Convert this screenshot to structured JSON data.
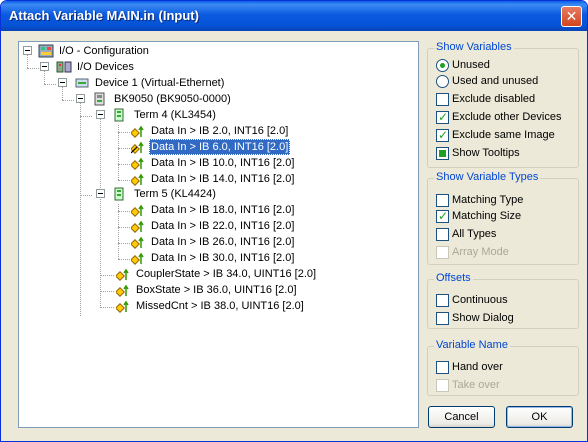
{
  "window": {
    "title": "Attach Variable MAIN.in (Input)",
    "close_glyph": "✕"
  },
  "tree": {
    "root": "I/O - Configuration",
    "io_devices": "I/O Devices",
    "device1": "Device 1 (Virtual-Ethernet)",
    "bk9050": "BK9050 (BK9050-0000)",
    "term4": "Term 4 (KL3454)",
    "term4_vars": [
      "Data In   >   IB 2.0, INT16 [2.0]",
      "Data In   >   IB 6.0, INT16 [2.0]",
      "Data In   >   IB 10.0, INT16 [2.0]",
      "Data In   >   IB 14.0, INT16 [2.0]"
    ],
    "term5": "Term 5 (KL4424)",
    "term5_vars": [
      "Data In   >   IB 18.0, INT16 [2.0]",
      "Data In   >   IB 22.0, INT16 [2.0]",
      "Data In   >   IB 26.0, INT16 [2.0]",
      "Data In   >   IB 30.0, INT16 [2.0]"
    ],
    "coupler_state": "CouplerState   >   IB 34.0, UINT16 [2.0]",
    "box_state": "BoxState   >   IB 36.0, UINT16 [2.0]",
    "missed_cnt": "MissedCnt   >   IB 38.0, UINT16 [2.0]"
  },
  "show_variables": {
    "legend": "Show Variables",
    "unused": "Unused",
    "used_and_unused": "Used and unused",
    "exclude_disabled": "Exclude disabled",
    "exclude_other_devices": "Exclude other Devices",
    "exclude_same_image": "Exclude same Image",
    "show_tooltips": "Show Tooltips"
  },
  "show_variable_types": {
    "legend": "Show Variable Types",
    "matching_type": "Matching Type",
    "matching_size": "Matching Size",
    "all_types": "All Types",
    "array_mode": "Array Mode"
  },
  "offsets": {
    "legend": "Offsets",
    "continuous": "Continuous",
    "show_dialog": "Show Dialog"
  },
  "variable_name": {
    "legend": "Variable Name",
    "hand_over": "Hand over",
    "take_over": "Take over"
  },
  "buttons": {
    "cancel": "Cancel",
    "ok": "OK"
  },
  "colors": {
    "selection": "#316ac5",
    "legend_text": "#0046d5",
    "check": "#21a121"
  }
}
